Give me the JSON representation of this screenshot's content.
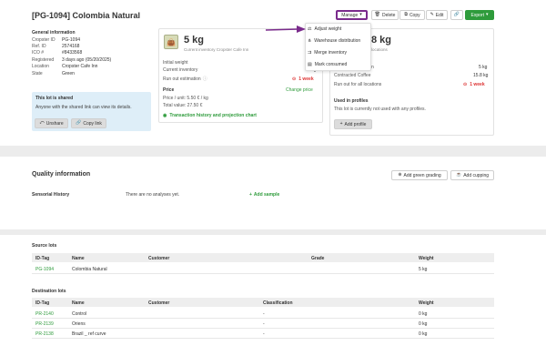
{
  "header": {
    "title": "[PG-1094] Colombia Natural",
    "manage_label": "Manage",
    "delete_label": "Delete",
    "copy_label": "Copy",
    "edit_label": "Edit",
    "export_label": "Export"
  },
  "general": {
    "title": "General information",
    "rows": [
      {
        "k": "Cropster ID",
        "v": "PG-1094"
      },
      {
        "k": "Ref. ID",
        "v": "2574168"
      },
      {
        "k": "ICO #",
        "v": "#8433568"
      },
      {
        "k": "Registered",
        "v": "3 days ago (05/20/2025)"
      },
      {
        "k": "Location",
        "v": "Cropster Cafe Inn"
      },
      {
        "k": "State",
        "v": "Green"
      }
    ],
    "shared_title": "This lot is shared",
    "shared_text": "Anyone with the shared link can view its details.",
    "unshare_label": "Unshare",
    "copy_link_label": "Copy link"
  },
  "inventory": {
    "amount": "5 kg",
    "subtitle": "Current inventory Cropster Cafe Inn",
    "initial_weight_label": "Initial weight",
    "current_inventory_label": "Current inventory",
    "current_inventory_value": "5 kg",
    "run_out_label": "Run out estimation",
    "run_out_value": "1 week",
    "price_title": "Price",
    "change_price_label": "Change price",
    "price_unit": "Price / unit: 5.50 € / kg",
    "total_value": "Total value: 27.50 €",
    "history_link": "Transaction history and projection chart"
  },
  "locations": {
    "amount": "8 kg",
    "subtitle": "locations",
    "row1_label": "n",
    "row1_value": "5 kg",
    "contracted_label": "Contracted Coffee",
    "contracted_value": "15.8 kg",
    "run_out_all_label": "Run out for all locations",
    "run_out_all_value": "1 week",
    "used_title": "Used in profiles",
    "used_text": "This lot is currently not used with any profiles.",
    "add_profile_label": "Add profile"
  },
  "manage_menu": {
    "items": [
      "Adjust weight",
      "Warehouse distribution",
      "Merge inventory",
      "Mark consumed"
    ]
  },
  "quality": {
    "title": "Quality information",
    "add_green_grading": "Add green grading",
    "add_cupping": "Add cupping",
    "sensorial_label": "Sensorial History",
    "no_analyses": "There are no analyses yet.",
    "add_sample": "Add sample"
  },
  "source": {
    "title": "Source lots",
    "headers": [
      "ID-Tag",
      "Name",
      "Customer",
      "Grade",
      "Weight"
    ],
    "rows": [
      {
        "id": "PG-1094",
        "name": "Colombia Natural",
        "customer": "",
        "grade": "",
        "weight": "5 kg"
      }
    ]
  },
  "destination": {
    "title": "Destination lots",
    "headers": [
      "ID-Tag",
      "Name",
      "Customer",
      "Classification",
      "Weight"
    ],
    "rows": [
      {
        "id": "PR-2140",
        "name": "Control",
        "customer": "",
        "class": "-",
        "weight": "0 kg"
      },
      {
        "id": "PR-2139",
        "name": "Oriens",
        "customer": "",
        "class": "-",
        "weight": "0 kg"
      },
      {
        "id": "PR-2138",
        "name": "Brazil _ ref curve",
        "customer": "",
        "class": "-",
        "weight": "0 kg"
      }
    ]
  },
  "colors": {
    "accent_green": "#2e9b3b",
    "highlight": "#7a2b8c",
    "danger": "#d33333"
  }
}
